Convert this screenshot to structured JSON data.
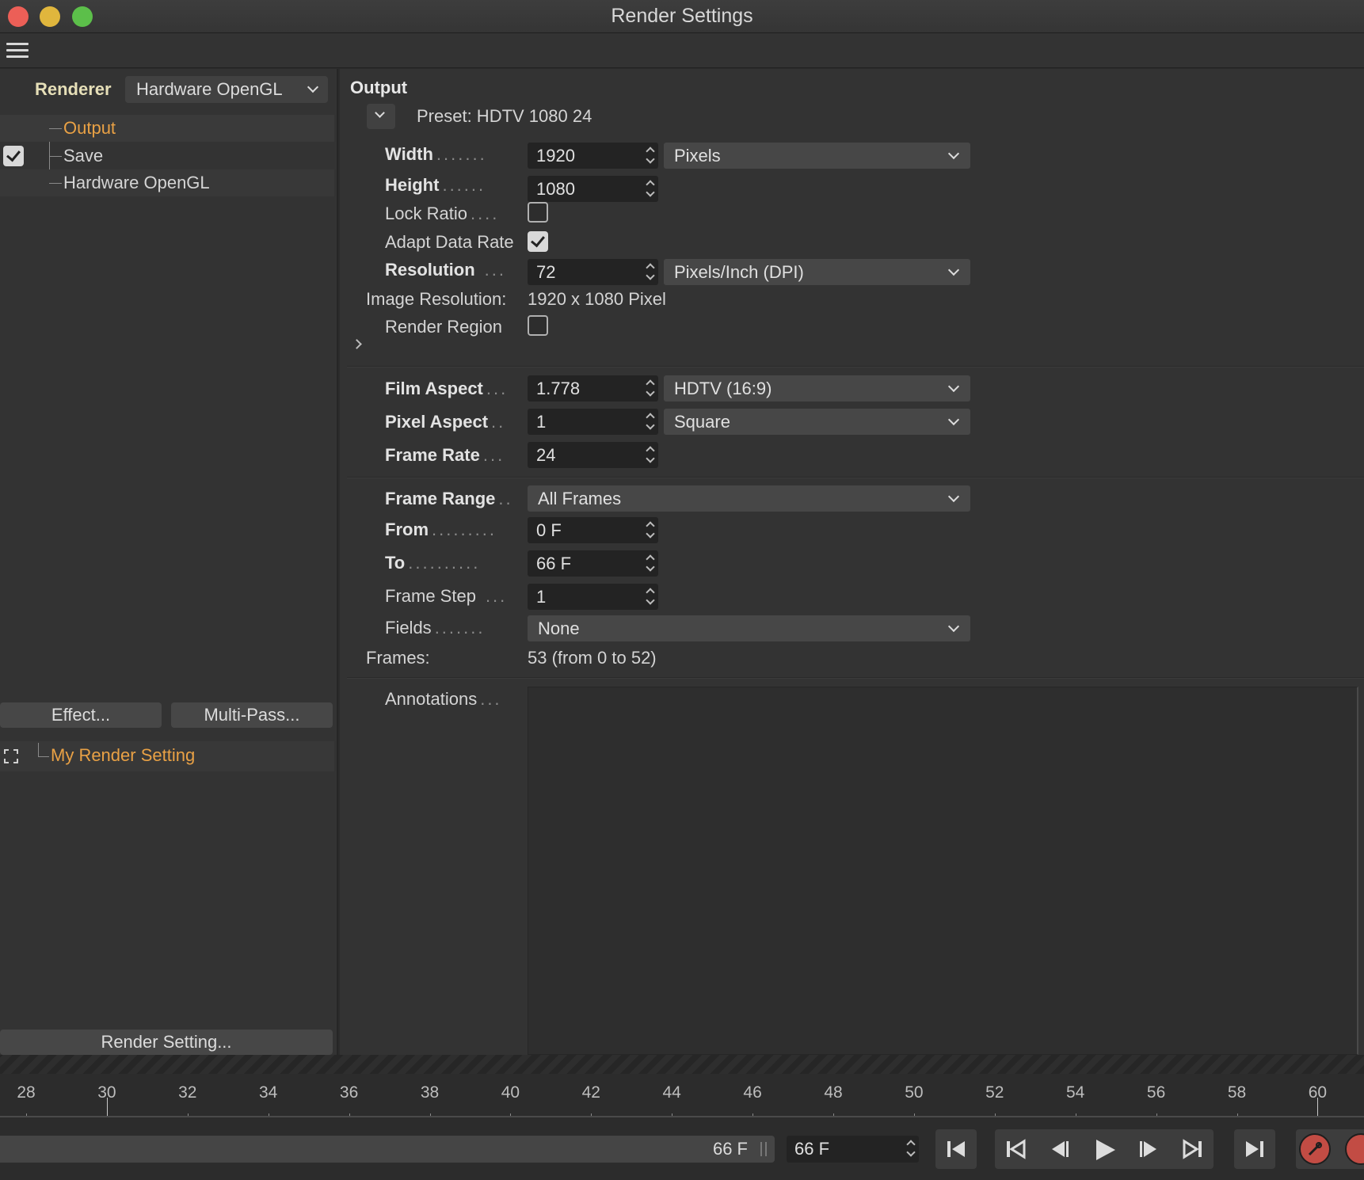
{
  "window": {
    "title": "Render Settings"
  },
  "left_panel": {
    "renderer_label": "Renderer",
    "renderer_value": "Hardware OpenGL",
    "tree": [
      {
        "label": "Output",
        "selected": true
      },
      {
        "label": "Save",
        "checked": true
      },
      {
        "label": "Hardware OpenGL"
      }
    ],
    "effect_button": "Effect...",
    "multipass_button": "Multi-Pass...",
    "render_setting_name": "My Render Setting",
    "render_setting_button": "Render Setting..."
  },
  "output": {
    "section_title": "Output",
    "preset": "Preset: HDTV 1080 24",
    "width": {
      "label": "Width",
      "value": "1920",
      "unit": "Pixels"
    },
    "height": {
      "label": "Height",
      "value": "1080"
    },
    "lock_ratio": {
      "label": "Lock Ratio",
      "checked": false
    },
    "adapt_data_rate": {
      "label": "Adapt Data Rate",
      "checked": true
    },
    "resolution": {
      "label": "Resolution",
      "value": "72",
      "unit": "Pixels/Inch (DPI)"
    },
    "image_resolution": {
      "label": "Image Resolution:",
      "value": "1920 x 1080 Pixel"
    },
    "render_region": {
      "label": "Render Region",
      "checked": false
    },
    "film_aspect": {
      "label": "Film Aspect",
      "value": "1.778",
      "preset": "HDTV (16:9)"
    },
    "pixel_aspect": {
      "label": "Pixel Aspect",
      "value": "1",
      "preset": "Square"
    },
    "frame_rate": {
      "label": "Frame Rate",
      "value": "24"
    },
    "frame_range": {
      "label": "Frame Range",
      "value": "All Frames"
    },
    "from": {
      "label": "From",
      "value": "0 F"
    },
    "to": {
      "label": "To",
      "value": "66 F"
    },
    "frame_step": {
      "label": "Frame Step",
      "value": "1"
    },
    "fields": {
      "label": "Fields",
      "value": "None"
    },
    "frames": {
      "label": "Frames:",
      "value": "53 (from 0 to 52)"
    },
    "annotations": {
      "label": "Annotations",
      "value": ""
    }
  },
  "timeline": {
    "ticks": [
      "28",
      "30",
      "32",
      "34",
      "36",
      "38",
      "40",
      "42",
      "44",
      "46",
      "48",
      "50",
      "52",
      "54",
      "56",
      "58",
      "60"
    ],
    "current_frame_display": "66 F",
    "current_frame_field": "66 F"
  },
  "colors": {
    "accent": "#e9a145",
    "panel": "#333333",
    "record": "#c24c44"
  },
  "icons": [
    "hamburger-icon",
    "chevron-down-icon",
    "checkmark-icon",
    "focus-icon",
    "go-to-start-icon",
    "previous-keyframe-icon",
    "step-back-icon",
    "play-icon",
    "step-forward-icon",
    "next-keyframe-icon",
    "go-to-end-icon",
    "record-icon"
  ]
}
